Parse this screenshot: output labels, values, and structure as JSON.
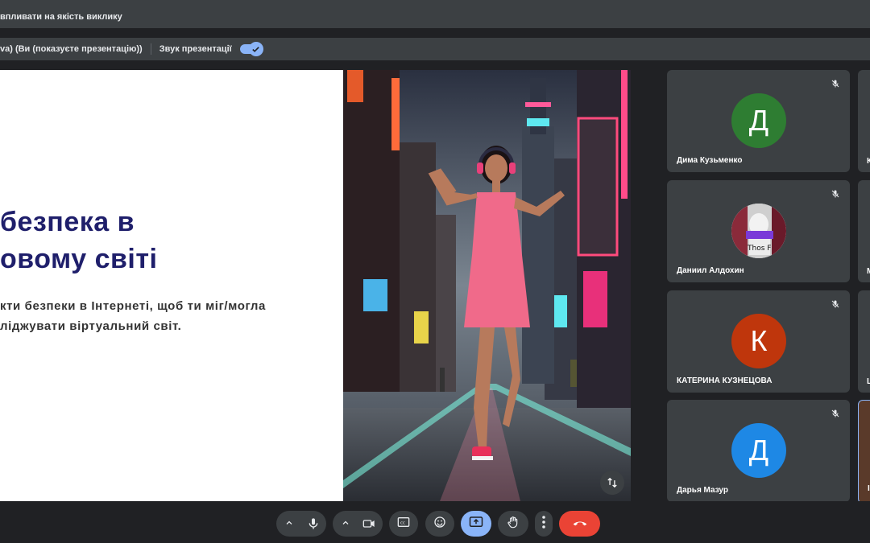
{
  "warning": {
    "text": "впливати на якість виклику"
  },
  "presenting": {
    "label": "va) (Ви (показуєте презентацію))",
    "sound_label": "Звук презентації",
    "sound_on": true
  },
  "slide": {
    "title_line1": "безпека в",
    "title_line2": "овому світі",
    "body_line1": "кти безпеки в Інтернеті, щоб ти міг/могла",
    "body_line2": "ліджувати віртуальний світ."
  },
  "participants": [
    {
      "name": "Дима Кузьменко",
      "initial": "Д",
      "color": "#2e7d32",
      "muted": true
    },
    {
      "name": "Даниил Алдохин",
      "initial": "",
      "color": "#666",
      "muted": true,
      "avatar_text": "Thos F"
    },
    {
      "name": "КАТЕРИНА КУЗНЕЦОВА",
      "initial": "К",
      "color": "#bf360c",
      "muted": true
    },
    {
      "name": "Дарья Мазур",
      "initial": "Д",
      "color": "#1e88e5",
      "muted": true
    }
  ],
  "cut_tiles": [
    {
      "letter": "К"
    },
    {
      "letter": "М"
    },
    {
      "letter": "L"
    },
    {
      "letter": "I"
    }
  ],
  "controls": {
    "mic_icon": "mic-icon",
    "camera_icon": "camera-icon",
    "captions_icon": "captions-icon",
    "emoji_icon": "emoji-icon",
    "present_icon": "present-icon",
    "hand_icon": "raise-hand-icon",
    "more_icon": "more-options-icon",
    "end_icon": "end-call-icon",
    "accent": "#8ab4f8",
    "end_color": "#ea4335"
  }
}
